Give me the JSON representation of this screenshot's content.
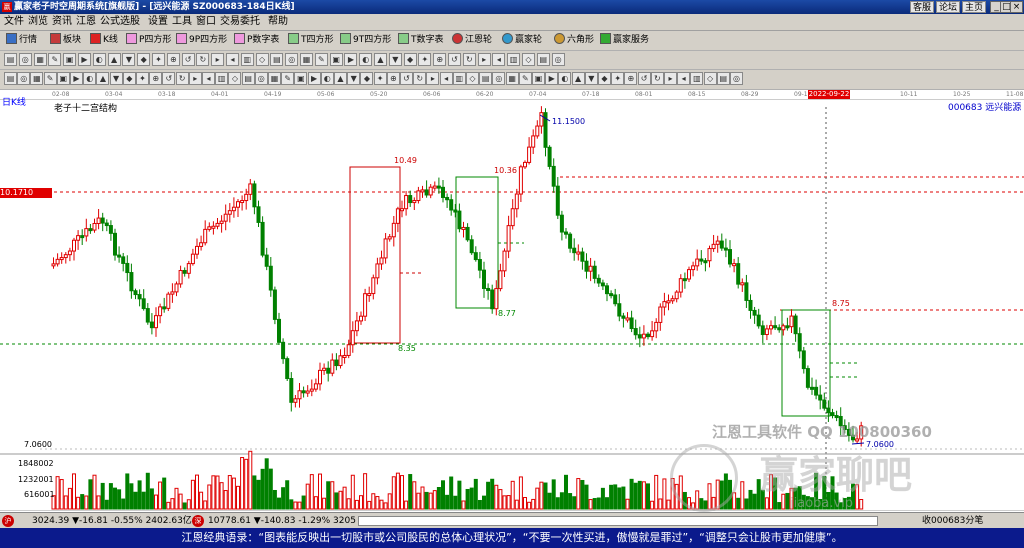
{
  "window": {
    "title": "赢家老子时空周期系统[旗舰版] - [远兴能源   SZ000683-184日K线]",
    "links": [
      "客服",
      "论坛",
      "主页"
    ],
    "controls": [
      "_",
      "□",
      "×"
    ]
  },
  "menu": [
    "文件",
    "浏览",
    "资讯",
    "江恩",
    "公式选股",
    "设置",
    "工具",
    "窗口",
    "交易委托",
    "帮助"
  ],
  "toolbar1": [
    "行情",
    "板块",
    "K线",
    "P四方形",
    "9P四方形",
    "P数字表",
    "T四方形",
    "9T四方形",
    "T数字表",
    "江恩轮",
    "赢家轮",
    "六角形",
    "赢家服务"
  ],
  "dates": [
    "02-08",
    "03-04",
    "03-18",
    "04-01",
    "04-19",
    "05-06",
    "05-20",
    "06-06",
    "06-20",
    "07-04",
    "07-18",
    "08-01",
    "08-15",
    "08-29",
    "09-13",
    "2022-09-22",
    "10-11",
    "10-25",
    "11-08"
  ],
  "chart": {
    "period_label": "日K线",
    "indicator_name": "老子十二宫结构",
    "stock": "000683  远兴能源",
    "price_marker": "10.1710",
    "low_label": "7.0600",
    "box_labels": {
      "high1": "10.49",
      "low1": "8.35",
      "high2": "10.36",
      "low2": "8.77",
      "high_peak": "11.1500",
      "high3": "8.75",
      "low_end": "7.0600"
    },
    "volume_ticks": [
      "1848002",
      "1232001",
      "616001"
    ],
    "watermark1": "江恩工具软件  QQ 100800360",
    "watermark2": "赢家聊吧",
    "watermark3": "jiaoba.vip"
  },
  "status": {
    "sh": "3024.39  ▼-16.81 -0.55% 2402.63亿",
    "sz": "10778.61  ▼-140.83 -1.29%  3205",
    "right": "收000683分笔"
  },
  "quote": "江恩经典语录：“图表能反映出一切股市或公司股民的总体心理状况”，“不要一次性买进，傲慢就是罪过”，“调整只会让股市更加健康”。"
}
